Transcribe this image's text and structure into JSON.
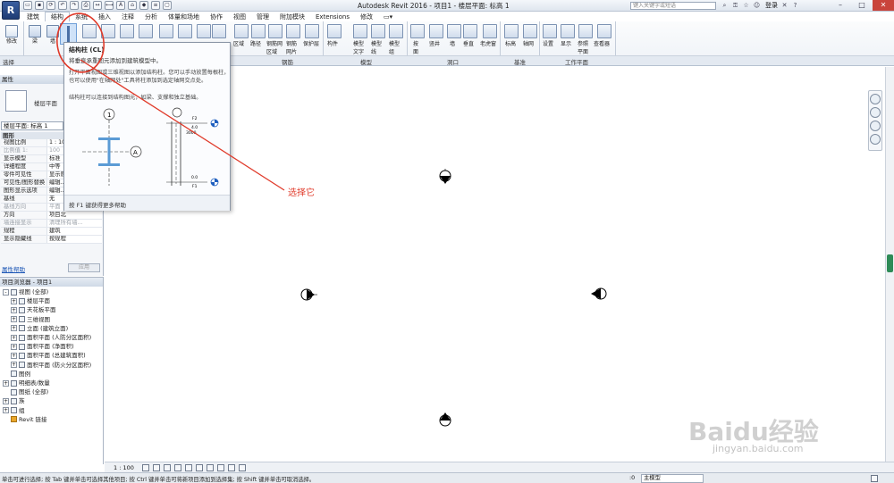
{
  "app": {
    "title": "Autodesk Revit 2016 -",
    "project": "项目1 - 楼层平面: 标高 1",
    "search_placeholder": "键入关键字或短语",
    "login": "登录"
  },
  "tabs": [
    "建筑",
    "结构",
    "系统",
    "插入",
    "注释",
    "分析",
    "体量和场地",
    "协作",
    "视图",
    "管理",
    "附加模块",
    "Extensions",
    "修改"
  ],
  "active_tab": "结构",
  "ribbon": {
    "select_label": "修改",
    "select_panel": "选择",
    "tools_left": [
      "梁",
      "墙"
    ],
    "tools_mid": [
      "区域",
      "路径",
      "钢筋网区域",
      "钢筋网片",
      "保护层"
    ],
    "tools_right": [
      "构件",
      "模型文字",
      "模型线",
      "模型组",
      "按面",
      "竖井",
      "墙",
      "垂直",
      "老虎窗",
      "标高",
      "轴网",
      "设置",
      "显示",
      "参照平面",
      "查看器"
    ],
    "panels": [
      "钢筋",
      "模型",
      "洞口",
      "基准",
      "工作平面"
    ]
  },
  "tooltip": {
    "title": "结构柱 (CL)",
    "desc": "将垂直承重图元添加到建筑模型中。",
    "body": "打开平面视图或三维视图以添加结构柱。您可以手动放置每根柱，也可以使用\"在轴网处\"工具将柱添加到选定轴网交点处。",
    "body2": "结构柱可以连接到结构图元，如梁、支撑和独立基础。",
    "footer": "按 F1 键获得更多帮助",
    "fig_grid_1": "1",
    "fig_grid_a": "A",
    "fig_top_label": "F2",
    "fig_mid_label1": "4.0",
    "fig_mid_label2": "3000",
    "fig_bot_label1": "0.0",
    "fig_bot_label2": "F1"
  },
  "annotation": {
    "text": "选择它",
    "color": "#e03a2a"
  },
  "properties": {
    "header": "属性",
    "type_name": "楼层平面",
    "view_selector": "楼层平面: 标高 1",
    "edit_type": "编辑类型",
    "section": "图形",
    "rows": [
      {
        "k": "视图比例",
        "v": "1 : 100",
        "dim": false
      },
      {
        "k": "比例值 1:",
        "v": "100",
        "dim": true
      },
      {
        "k": "显示模型",
        "v": "标准",
        "dim": false
      },
      {
        "k": "详细程度",
        "v": "中等",
        "dim": false
      },
      {
        "k": "零件可见性",
        "v": "显示原状态",
        "dim": false
      },
      {
        "k": "可见性/图形替换",
        "v": "编辑...",
        "dim": false
      },
      {
        "k": "图形显示选项",
        "v": "编辑...",
        "dim": false
      },
      {
        "k": "基线",
        "v": "无",
        "dim": false
      },
      {
        "k": "基线方向",
        "v": "平面",
        "dim": true
      },
      {
        "k": "方向",
        "v": "项目北",
        "dim": false
      },
      {
        "k": "墙连接显示",
        "v": "清理所有墙...",
        "dim": true
      },
      {
        "k": "规程",
        "v": "建筑",
        "dim": false
      },
      {
        "k": "显示隐藏线",
        "v": "按规程",
        "dim": false
      }
    ],
    "help": "属性帮助",
    "apply": "应用"
  },
  "browser": {
    "header": "项目浏览器 - 项目1",
    "items": [
      {
        "label": "视图 (全部)",
        "level": 0,
        "exp": "-"
      },
      {
        "label": "楼层平面",
        "level": 1,
        "exp": "+"
      },
      {
        "label": "天花板平面",
        "level": 1,
        "exp": "+"
      },
      {
        "label": "三维视图",
        "level": 1,
        "exp": "+"
      },
      {
        "label": "立面 (建筑立面)",
        "level": 1,
        "exp": "+"
      },
      {
        "label": "面积平面 (人防分区面积)",
        "level": 1,
        "exp": "+"
      },
      {
        "label": "面积平面 (净面积)",
        "level": 1,
        "exp": "+"
      },
      {
        "label": "面积平面 (总建筑面积)",
        "level": 1,
        "exp": "+"
      },
      {
        "label": "面积平面 (防火分区面积)",
        "level": 1,
        "exp": "+"
      },
      {
        "label": "图例",
        "level": 0,
        "exp": ""
      },
      {
        "label": "明细表/数量",
        "level": 0,
        "exp": "+"
      },
      {
        "label": "图纸 (全部)",
        "level": 0,
        "exp": ""
      },
      {
        "label": "族",
        "level": 0,
        "exp": "+"
      },
      {
        "label": "组",
        "level": 0,
        "exp": "+"
      },
      {
        "label": "Revit 链接",
        "level": 0,
        "exp": ""
      }
    ]
  },
  "view_control": {
    "scale": "1 : 100"
  },
  "status": {
    "text": "单击可进行选择; 按 Tab 键并单击可选择其他项目; 按 Ctrl 键并单击可将新项目添加到选择集; 按 Shift 键并单击可取消选择。",
    "zero": ":0",
    "model": "主模型"
  },
  "watermark": {
    "logo": "Baidu经验",
    "url": "jingyan.baidu.com"
  }
}
